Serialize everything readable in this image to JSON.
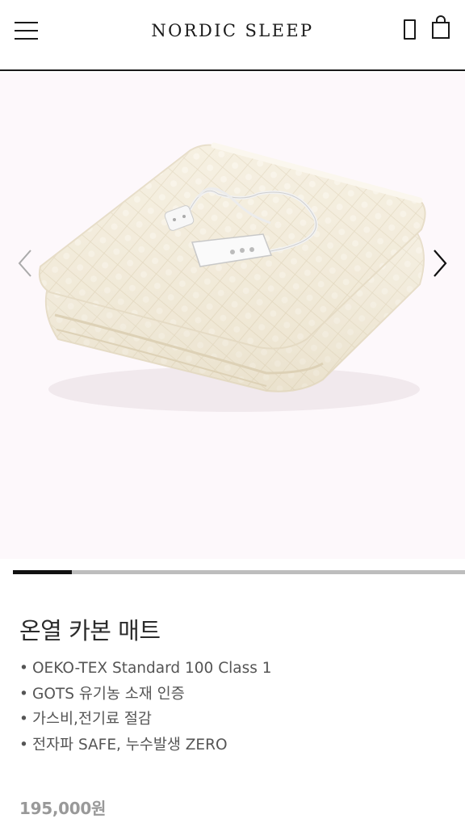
{
  "header": {
    "brand": "NORDIC SLEEP",
    "menu_icon": "hamburger-menu-icon",
    "account_icon": "account-icon",
    "cart_icon": "shopping-bag-icon"
  },
  "gallery": {
    "prev_icon": "chevron-left-icon",
    "next_icon": "chevron-right-icon",
    "image_subject": "folded cream quilted electric blanket with controller",
    "progress": 0.13,
    "background": "#fdf8fb"
  },
  "product": {
    "title": "온열 카본 매트",
    "features": [
      "OEKO-TEX Standard 100 Class 1",
      "GOTS 유기농 소재 인증",
      "가스비,전기료 절감",
      "전자파 SAFE, 누수발생 ZERO"
    ],
    "price": "195,000원"
  },
  "colors": {
    "text_dark": "#1a1a1a",
    "price_gray": "#999999",
    "progress_track": "#bdbdbd",
    "progress_fill": "#111111"
  }
}
